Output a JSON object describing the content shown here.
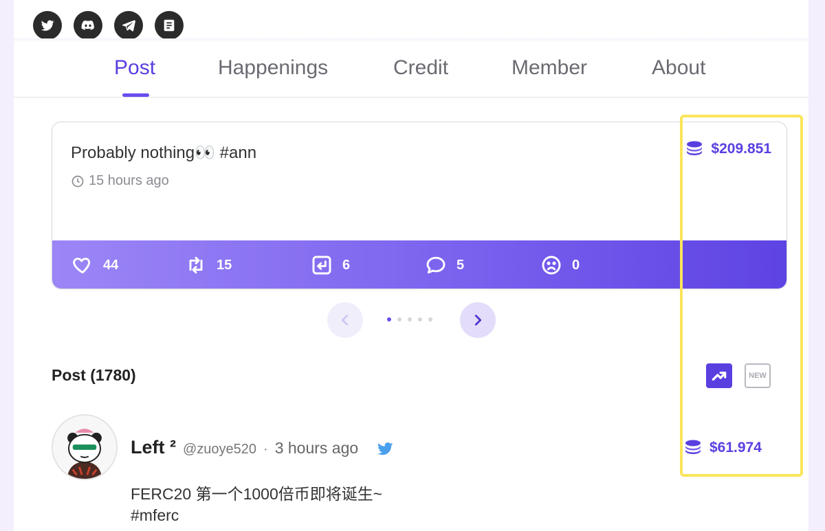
{
  "social": {
    "items": [
      {
        "icon": "twitter-icon"
      },
      {
        "icon": "discord-icon"
      },
      {
        "icon": "telegram-icon"
      },
      {
        "icon": "document-icon"
      }
    ]
  },
  "tabs": [
    {
      "label": "Post",
      "active": true
    },
    {
      "label": "Happenings"
    },
    {
      "label": "Credit"
    },
    {
      "label": "Member"
    },
    {
      "label": "About"
    }
  ],
  "featured": {
    "title": "Probably nothing👀  #ann",
    "time": "15 hours ago",
    "price": "$209.851",
    "actions": {
      "like": "44",
      "retweet": "15",
      "quote": "6",
      "reply": "5",
      "dislike": "0"
    }
  },
  "pager": {
    "dots": 5,
    "active_dot": 0
  },
  "posts": {
    "count_label": "Post (1780)",
    "sort_new_label": "NEW",
    "items": [
      {
        "author": "Left ²",
        "handle": "@zuoye520",
        "separator": "·",
        "time": "3 hours ago",
        "price": "$61.974",
        "text_line1": "FERC20 第一个1000倍币即将诞生~",
        "text_line2": "#mferc"
      }
    ]
  },
  "colors": {
    "accent": "#5a3fe0",
    "highlight": "#fae55a"
  }
}
